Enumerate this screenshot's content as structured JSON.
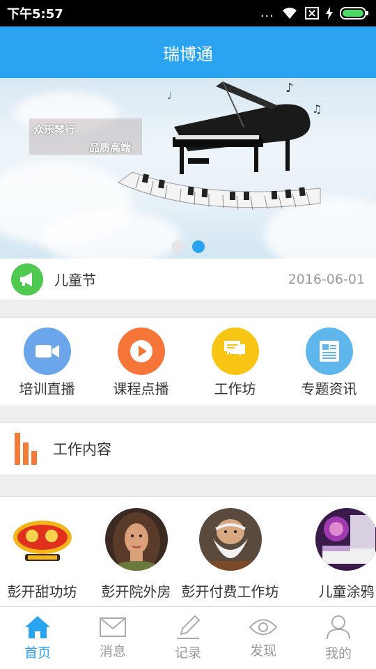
{
  "status_bar": {
    "time": "下午5:57",
    "more_glyph": "..."
  },
  "app": {
    "title": "瑞博通"
  },
  "banner": {
    "tag_line_1": "众乐琴行",
    "tag_line_2": "品质高端",
    "page_count": 2,
    "active_page": 2
  },
  "notice": {
    "label": "儿童节",
    "date": "2016-06-01",
    "icon": "megaphone-icon"
  },
  "quick_menu": [
    {
      "label": "培训直播",
      "icon": "video-camera-icon",
      "color": "#6aa6e9"
    },
    {
      "label": "课程点播",
      "icon": "play-icon",
      "color": "#f6763a"
    },
    {
      "label": "工作坊",
      "icon": "chat-bubbles-icon",
      "color": "#f8c515"
    },
    {
      "label": "专题资讯",
      "icon": "newspaper-icon",
      "color": "#5fb6ec"
    }
  ],
  "section": {
    "label": "工作内容",
    "icon": "bar-chart-icon"
  },
  "workshops": [
    {
      "name": "彭开甜功坊",
      "avatar": "game-logo"
    },
    {
      "name": "彭开院外房",
      "avatar": "woman-portrait"
    },
    {
      "name": "彭开付费工作坊",
      "avatar": "old-man-portrait"
    },
    {
      "name": "儿童涂鸦",
      "avatar": "purple-room"
    }
  ],
  "bottom_nav": [
    {
      "label": "首页",
      "icon": "home-icon",
      "active": true
    },
    {
      "label": "消息",
      "icon": "envelope-icon",
      "active": false
    },
    {
      "label": "记录",
      "icon": "pencil-icon",
      "active": false
    },
    {
      "label": "发现",
      "icon": "eye-icon",
      "active": false
    },
    {
      "label": "我的",
      "icon": "user-icon",
      "active": false
    }
  ],
  "colors": {
    "primary": "#2aa3f0",
    "notice_green": "#4fc94f",
    "accent_orange": "#f37b3a"
  }
}
